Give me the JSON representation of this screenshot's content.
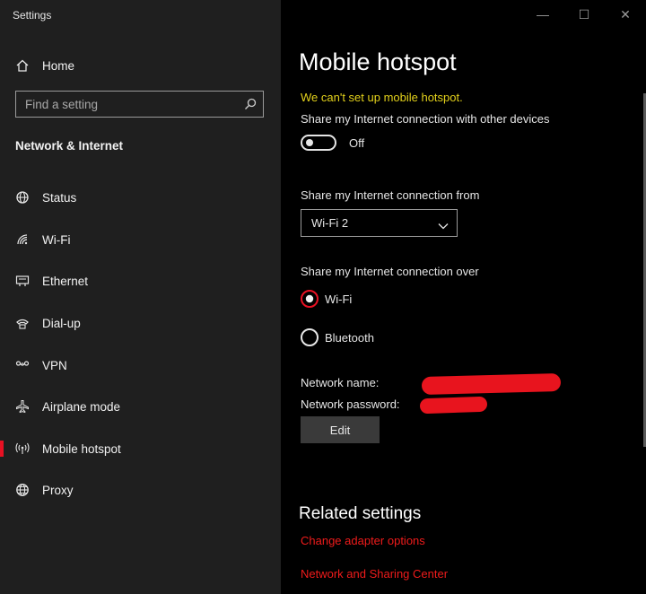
{
  "window": {
    "title": "Settings",
    "controls": {
      "minimize": "—",
      "maximize": "☐",
      "close": "✕"
    }
  },
  "sidebar": {
    "home_label": "Home",
    "search": {
      "placeholder": "Find a setting",
      "value": ""
    },
    "section_heading": "Network & Internet",
    "items": [
      {
        "label": "Status",
        "icon": "globe-status-icon",
        "active": false
      },
      {
        "label": "Wi-Fi",
        "icon": "wifi-icon",
        "active": false
      },
      {
        "label": "Ethernet",
        "icon": "ethernet-icon",
        "active": false
      },
      {
        "label": "Dial-up",
        "icon": "phone-icon",
        "active": false
      },
      {
        "label": "VPN",
        "icon": "vpn-icon",
        "active": false
      },
      {
        "label": "Airplane mode",
        "icon": "airplane-icon",
        "active": false
      },
      {
        "label": "Mobile hotspot",
        "icon": "hotspot-icon",
        "active": true
      },
      {
        "label": "Proxy",
        "icon": "globe-icon",
        "active": false
      }
    ]
  },
  "main": {
    "title": "Mobile hotspot",
    "warning": "We can't set up mobile hotspot.",
    "share_label": "Share my Internet connection with other devices",
    "toggle": {
      "state_label": "Off",
      "on": false
    },
    "share_from_label": "Share my Internet connection from",
    "share_from_value": "Wi-Fi 2",
    "share_over_label": "Share my Internet connection over",
    "share_over_options": [
      {
        "label": "Wi-Fi",
        "selected": true
      },
      {
        "label": "Bluetooth",
        "selected": false
      }
    ],
    "network_name_label": "Network name:",
    "network_password_label": "Network password:",
    "edit_label": "Edit",
    "related_title": "Related settings",
    "links": [
      "Change adapter options",
      "Network and Sharing Center"
    ]
  },
  "colors": {
    "accent": "#e81123",
    "warning": "#e3d11b",
    "link": "#ef1b1b",
    "sidebar_bg": "#1f1f1f",
    "main_bg": "#000000"
  }
}
